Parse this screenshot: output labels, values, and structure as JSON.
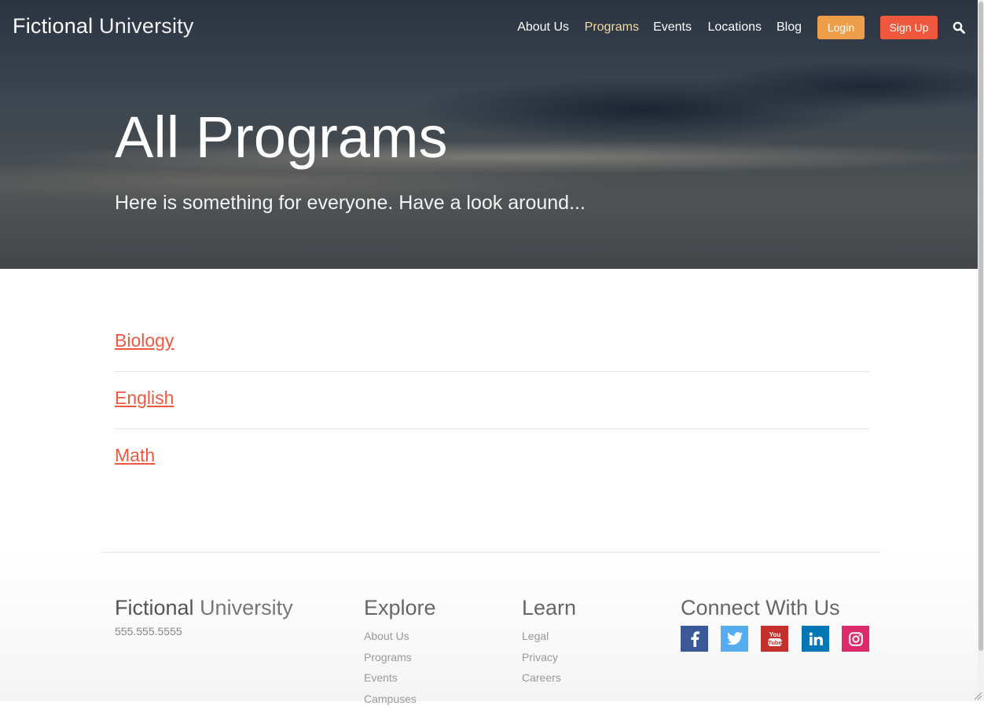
{
  "header": {
    "brand_bold": "Fictional",
    "brand_light": "University",
    "nav": [
      {
        "label": "About Us"
      },
      {
        "label": "Programs"
      },
      {
        "label": "Events"
      },
      {
        "label": "Locations"
      },
      {
        "label": "Blog"
      }
    ],
    "active_nav": "Programs",
    "login_label": "Login",
    "signup_label": "Sign Up",
    "search_icon": "search-icon"
  },
  "hero": {
    "title": "All Programs",
    "subtitle": "Here is something for everyone. Have a look around..."
  },
  "programs": [
    {
      "label": "Biology"
    },
    {
      "label": "English"
    },
    {
      "label": "Math"
    }
  ],
  "footer": {
    "brand_bold": "Fictional",
    "brand_light": "University",
    "phone": "555.555.5555",
    "explore": {
      "heading": "Explore",
      "links": [
        "About Us",
        "Programs",
        "Events",
        "Campuses"
      ]
    },
    "learn": {
      "heading": "Learn",
      "links": [
        "Legal",
        "Privacy",
        "Careers"
      ]
    },
    "connect": {
      "heading": "Connect With Us",
      "icons": [
        "facebook-icon",
        "twitter-icon",
        "youtube-icon",
        "linkedin-icon",
        "instagram-icon"
      ]
    }
  },
  "colors": {
    "accent": "#f0583e",
    "login": "#ee9d49",
    "active_nav": "#f5d9a0",
    "facebook": "#3b5998",
    "twitter": "#55acee",
    "youtube": "#c4302b",
    "linkedin": "#0077b5",
    "instagram": "#dc2a6b"
  }
}
